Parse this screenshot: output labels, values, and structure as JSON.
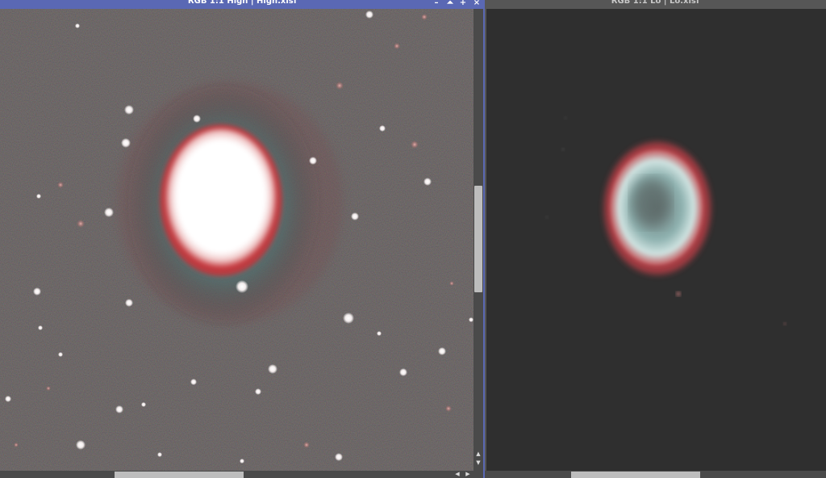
{
  "windows": {
    "high": {
      "title": "RGB 1:1 High | High.xisf",
      "controls": {
        "minimize": "–",
        "shade": "⏶",
        "maximize": "+",
        "close": "×"
      },
      "scroll_arrows": {
        "up": "▲",
        "down": "▼",
        "left": "◀",
        "right": "▶"
      }
    },
    "lo": {
      "title": "RGB 1:1 Lo | Lo.xisf"
    }
  },
  "colors": {
    "active_frame": "#5a68b4",
    "inactive_frame": "#565656",
    "sky_high": "#3e3c3c",
    "sky_lo": "#2f2f2f",
    "nebula_core": "#ffffff",
    "nebula_rim": "#d9383c",
    "nebula_halo": "#5e8c8a"
  }
}
